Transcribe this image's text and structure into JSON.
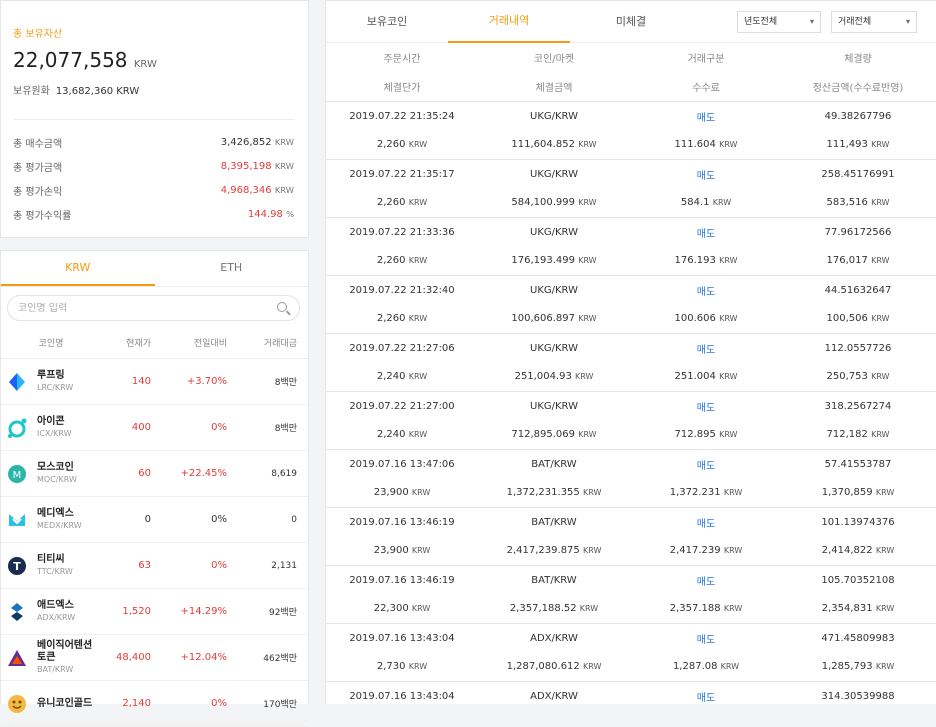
{
  "assets": {
    "total_label": "총 보유자산",
    "total_value": "22,077,558",
    "total_unit": "KRW",
    "krw_label": "보유원화",
    "krw_value": "13,682,360 KRW",
    "rows": [
      {
        "label": "총 매수금액",
        "value": "3,426,852",
        "unit": "KRW",
        "color": "#333333"
      },
      {
        "label": "총 평가금액",
        "value": "8,395,198",
        "unit": "KRW",
        "color": "#e23c3c"
      },
      {
        "label": "총 평가손익",
        "value": "4,968,346",
        "unit": "KRW",
        "color": "#e23c3c"
      },
      {
        "label": "총 평가수익률",
        "value": "144.98",
        "unit": "%",
        "color": "#e23c3c"
      }
    ]
  },
  "market": {
    "tabs": [
      "KRW",
      "ETH"
    ],
    "search_placeholder": "코인명 입력",
    "headers": [
      "코인명",
      "현재가",
      "전일대비",
      "거래대금"
    ],
    "coins": [
      {
        "name": "루프링",
        "market": "LRC/KRW",
        "price": "140",
        "change": "+3.70%",
        "volume": "8백만",
        "icon": "loopring-icon",
        "zero": false
      },
      {
        "name": "아이콘",
        "market": "ICX/KRW",
        "price": "400",
        "change": "0%",
        "volume": "8백만",
        "icon": "icon-coin-icon",
        "zero": false
      },
      {
        "name": "모스코인",
        "market": "MOC/KRW",
        "price": "60",
        "change": "+22.45%",
        "volume": "8,619",
        "icon": "moss-icon",
        "zero": false
      },
      {
        "name": "메디엑스",
        "market": "MEDX/KRW",
        "price": "0",
        "change": "0%",
        "volume": "0",
        "icon": "medx-icon",
        "zero": true
      },
      {
        "name": "티티씨",
        "market": "TTC/KRW",
        "price": "63",
        "change": "0%",
        "volume": "2,131",
        "icon": "ttc-icon",
        "zero": false
      },
      {
        "name": "애드엑스",
        "market": "ADX/KRW",
        "price": "1,520",
        "change": "+14.29%",
        "volume": "92백만",
        "icon": "adx-icon",
        "zero": false
      },
      {
        "name": "베이직어텐션토큰",
        "market": "BAT/KRW",
        "price": "48,400",
        "change": "+12.04%",
        "volume": "462백만",
        "icon": "bat-icon",
        "zero": false
      },
      {
        "name": "유니코인골드",
        "market": "",
        "price": "2,140",
        "change": "0%",
        "volume": "170백만",
        "icon": "unicoin-icon",
        "zero": false
      }
    ]
  },
  "history": {
    "tabs": [
      "보유코인",
      "거래내역",
      "미체결"
    ],
    "filter_year": "년도전체",
    "filter_type": "거래전체",
    "headers1": [
      "주문시간",
      "코인/마켓",
      "거래구분",
      "체결량"
    ],
    "headers2": [
      "체결단가",
      "체결금액",
      "수수료",
      "정산금액(수수료반영)"
    ],
    "rows": [
      {
        "time": "2019.07.22 21:35:24",
        "pair": "UKG/KRW",
        "side": "매도",
        "qty": "49.38267796",
        "price": "2,260",
        "amount": "111,604.852",
        "fee": "111.604",
        "settle": "111,493"
      },
      {
        "time": "2019.07.22 21:35:17",
        "pair": "UKG/KRW",
        "side": "매도",
        "qty": "258.45176991",
        "price": "2,260",
        "amount": "584,100.999",
        "fee": "584.1",
        "settle": "583,516"
      },
      {
        "time": "2019.07.22 21:33:36",
        "pair": "UKG/KRW",
        "side": "매도",
        "qty": "77.96172566",
        "price": "2,260",
        "amount": "176,193.499",
        "fee": "176.193",
        "settle": "176,017"
      },
      {
        "time": "2019.07.22 21:32:40",
        "pair": "UKG/KRW",
        "side": "매도",
        "qty": "44.51632647",
        "price": "2,260",
        "amount": "100,606.897",
        "fee": "100.606",
        "settle": "100,506"
      },
      {
        "time": "2019.07.22 21:27:06",
        "pair": "UKG/KRW",
        "side": "매도",
        "qty": "112.0557726",
        "price": "2,240",
        "amount": "251,004.93",
        "fee": "251.004",
        "settle": "250,753"
      },
      {
        "time": "2019.07.22 21:27:00",
        "pair": "UKG/KRW",
        "side": "매도",
        "qty": "318.2567274",
        "price": "2,240",
        "amount": "712,895.069",
        "fee": "712.895",
        "settle": "712,182"
      },
      {
        "time": "2019.07.16 13:47:06",
        "pair": "BAT/KRW",
        "side": "매도",
        "qty": "57.41553787",
        "price": "23,900",
        "amount": "1,372,231.355",
        "fee": "1,372.231",
        "settle": "1,370,859"
      },
      {
        "time": "2019.07.16 13:46:19",
        "pair": "BAT/KRW",
        "side": "매도",
        "qty": "101.13974376",
        "price": "23,900",
        "amount": "2,417,239.875",
        "fee": "2,417.239",
        "settle": "2,414,822"
      },
      {
        "time": "2019.07.16 13:46:19",
        "pair": "BAT/KRW",
        "side": "매도",
        "qty": "105.70352108",
        "price": "22,300",
        "amount": "2,357,188.52",
        "fee": "2,357.188",
        "settle": "2,354,831"
      },
      {
        "time": "2019.07.16 13:43:04",
        "pair": "ADX/KRW",
        "side": "매도",
        "qty": "471.45809983",
        "price": "2,730",
        "amount": "1,287,080.612",
        "fee": "1,287.08",
        "settle": "1,285,793"
      },
      {
        "time": "2019.07.16 13:43:04",
        "pair": "ADX/KRW",
        "side": "매도",
        "qty": "314.30539988",
        "price": "",
        "amount": "",
        "fee": "",
        "settle": ""
      }
    ],
    "unit": "KRW"
  }
}
